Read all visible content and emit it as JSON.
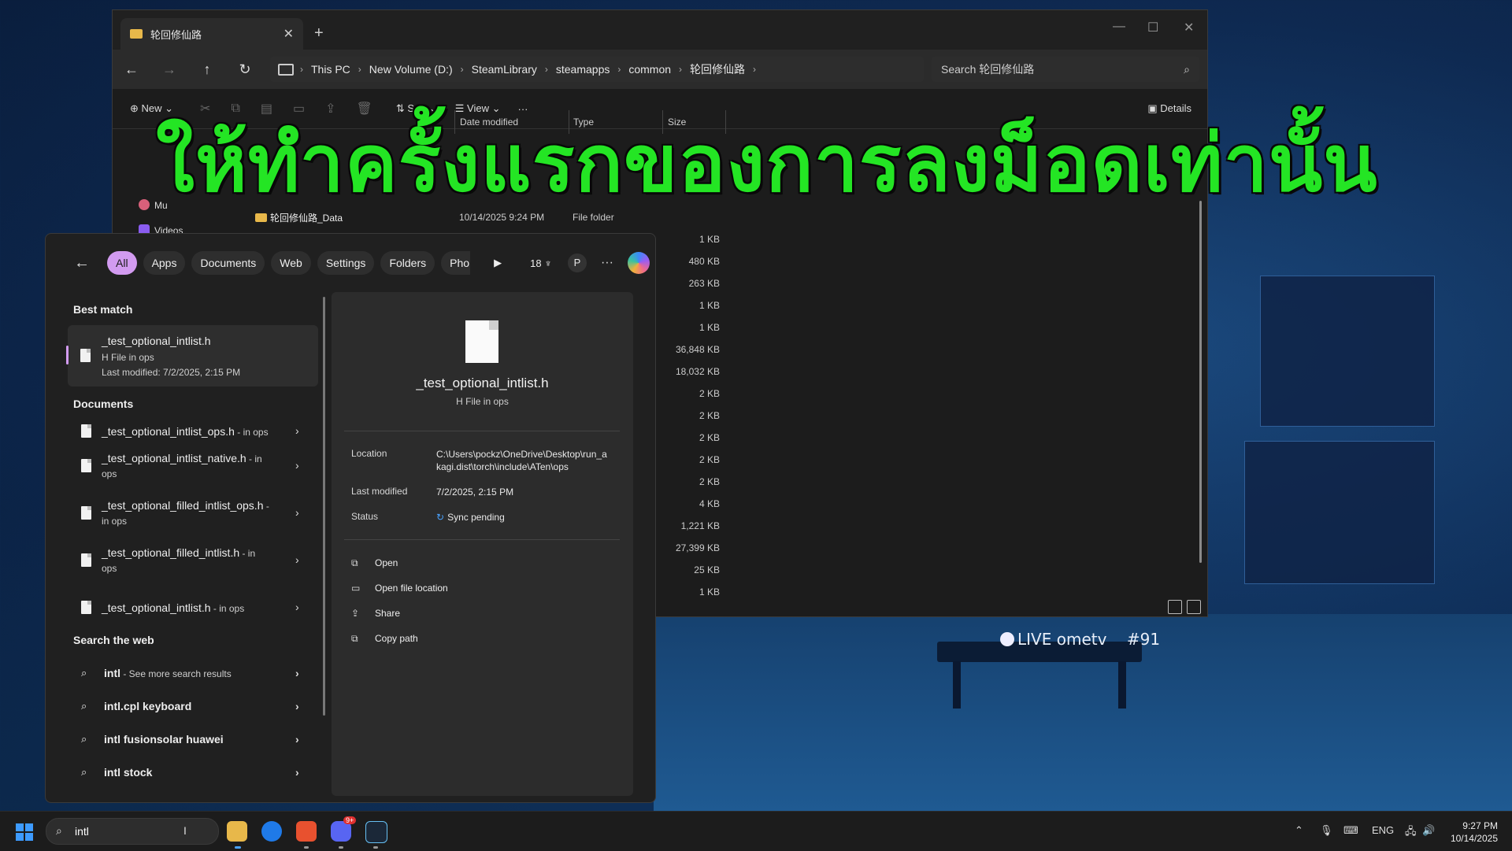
{
  "explorer": {
    "tab_title": "轮回修仙路",
    "tab_close": "✕",
    "new_tab": "+",
    "breadcrumb": [
      "This PC",
      "New Volume (D:)",
      "SteamLibrary",
      "steamapps",
      "common",
      "轮回修仙路"
    ],
    "search_placeholder": "Search 轮回修仙路",
    "toolbar": {
      "new": "New",
      "sort": "Sort",
      "view": "View",
      "more": "···",
      "details": "Details"
    },
    "columns": {
      "date": "Date modified",
      "type": "Type",
      "size": "Size"
    },
    "nav_pane": [
      "Mu",
      "Videos"
    ],
    "rows": [
      {
        "name": "轮回修仙路_Data",
        "date": "10/14/2025 9:24 PM",
        "type": "File folder"
      }
    ],
    "sizes": [
      "1 KB",
      "480 KB",
      "263 KB",
      "1 KB",
      "1 KB",
      "36,848 KB",
      "18,032 KB",
      "2 KB",
      "2 KB",
      "2 KB",
      "2 KB",
      "2 KB",
      "4 KB",
      "1,221 KB",
      "27,399 KB",
      "25 KB",
      "1 KB"
    ]
  },
  "caption": "ให้ทำครั้งแรกของการลงม็อดเท่านั้น",
  "stream_overlay": {
    "live": "LIVE",
    "brand": "ometv",
    "tag": "#91"
  },
  "search": {
    "filters": [
      "All",
      "Apps",
      "Documents",
      "Web",
      "Settings",
      "Folders",
      "Pho"
    ],
    "reward_count": "18",
    "avatar_letter": "P",
    "best_match": {
      "heading": "Best match",
      "title": "_test_optional_intlist.h",
      "subtitle": "H File in ops",
      "modified": "Last modified: 7/2/2025, 2:15 PM"
    },
    "documents_heading": "Documents",
    "documents": [
      {
        "name": "_test_optional_intlist_ops.h",
        "loc": " - in ops"
      },
      {
        "name": "_test_optional_intlist_native.h",
        "loc": " - in ops"
      },
      {
        "name": "_test_optional_filled_intlist_ops.h",
        "loc": " - in ops"
      },
      {
        "name": "_test_optional_filled_intlist.h",
        "loc": " - in ops"
      },
      {
        "name": "_test_optional_intlist.h",
        "loc": " - in ops"
      }
    ],
    "web_heading": "Search the web",
    "web": [
      {
        "term": "intl",
        "extra": " - See more search results"
      },
      {
        "term": "intl.cpl keyboard",
        "extra": ""
      },
      {
        "term": "intl fusionsolar huawei",
        "extra": ""
      },
      {
        "term": "intl stock",
        "extra": ""
      }
    ],
    "preview": {
      "title": "_test_optional_intlist.h",
      "subtitle": "H File in ops",
      "location_label": "Location",
      "location": "C:\\Users\\pockz\\OneDrive\\Desktop\\run_akagi.dist\\torch\\include\\ATen\\ops",
      "modified_label": "Last modified",
      "modified": "7/2/2025, 2:15 PM",
      "status_label": "Status",
      "status": "Sync pending",
      "actions": [
        "Open",
        "Open file location",
        "Share",
        "Copy path"
      ]
    }
  },
  "taskbar": {
    "query": "intl",
    "language": "ENG",
    "time": "9:27 PM",
    "date": "10/14/2025",
    "discord_badge": "9+"
  }
}
